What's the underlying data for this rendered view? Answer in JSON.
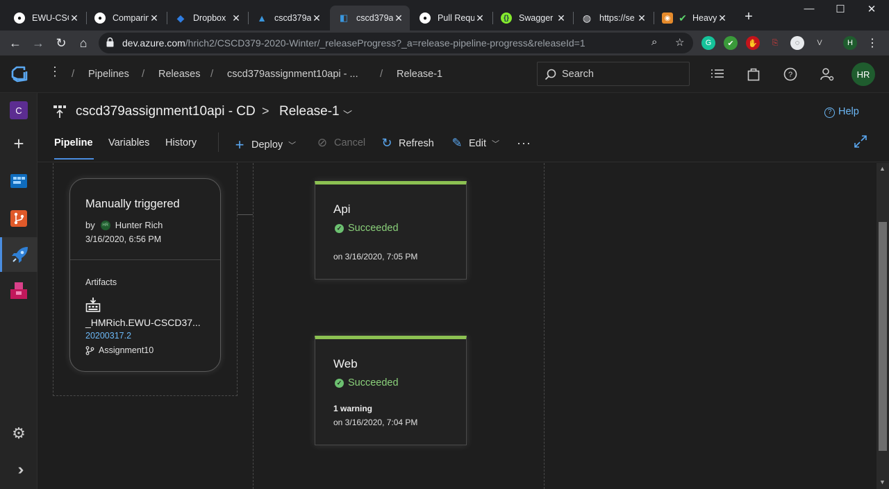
{
  "browser": {
    "tabs": [
      {
        "title": "EWU-CSC",
        "favicon": "github-icon"
      },
      {
        "title": "Comparin",
        "favicon": "github-icon"
      },
      {
        "title": "Dropbox",
        "favicon": "dropbox-icon"
      },
      {
        "title": "cscd379a",
        "favicon": "azure-icon"
      },
      {
        "title": "cscd379a",
        "favicon": "azure-devops-icon",
        "active": true
      },
      {
        "title": "Pull Requ",
        "favicon": "github-icon"
      },
      {
        "title": "Swagger",
        "favicon": "swagger-icon"
      },
      {
        "title": "https://se",
        "favicon": "globe-icon"
      },
      {
        "title": "Heavy",
        "favicon": "heavy-icon"
      }
    ],
    "url_host": "dev.azure.com",
    "url_path": "/hrich2/CSCD379-2020-Winter/_releaseProgress?_a=release-pipeline-progress&releaseId=1",
    "profile_initial": "H"
  },
  "header": {
    "breadcrumbs": [
      "Pipelines",
      "Releases",
      "cscd379assignment10api - ...",
      "Release-1"
    ],
    "search_placeholder": "Search",
    "user_initials": "HR"
  },
  "rail": {
    "org_initial": "C"
  },
  "page": {
    "pipeline_name": "cscd379assignment10api - CD",
    "chevron": ">",
    "release_name": "Release-1",
    "help_label": "Help",
    "tabs": [
      "Pipeline",
      "Variables",
      "History"
    ],
    "commands": {
      "deploy": "Deploy",
      "cancel": "Cancel",
      "refresh": "Refresh",
      "edit": "Edit",
      "more": "···"
    }
  },
  "artifact_card": {
    "title": "Manually triggered",
    "by_prefix": "by",
    "user_badge": "HR",
    "user_name": "Hunter Rich",
    "date": "3/16/2020, 6:56 PM",
    "artifacts_label": "Artifacts",
    "artifact_name": "_HMRich.EWU-CSCD37...",
    "artifact_version": "20200317.2",
    "artifact_branch": "Assignment10"
  },
  "stages": [
    {
      "name": "Api",
      "status": "Succeeded",
      "warning": "",
      "date": "on 3/16/2020, 7:05 PM"
    },
    {
      "name": "Web",
      "status": "Succeeded",
      "warning": "1 warning",
      "date": "on 3/16/2020, 7:04 PM"
    }
  ],
  "colors": {
    "accent": "#4a8de0",
    "success": "#8cc152",
    "link": "#6cb8f6"
  }
}
